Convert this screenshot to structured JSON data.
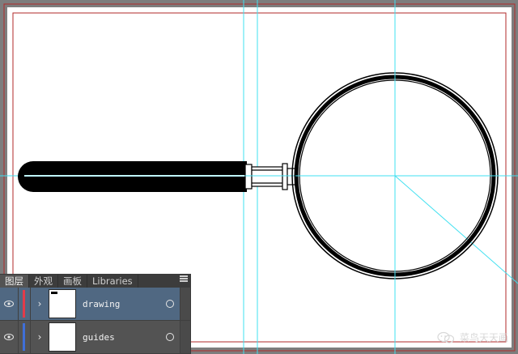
{
  "layers_panel": {
    "tabs": [
      {
        "label": "图层",
        "active": true
      },
      {
        "label": "外观",
        "active": false
      },
      {
        "label": "画板",
        "active": false
      },
      {
        "label": "Libraries",
        "active": false
      }
    ],
    "layers": [
      {
        "name": "drawing",
        "color": "#e23b4a",
        "selected": true,
        "icon": "eye-icon"
      },
      {
        "name": "guides",
        "color": "#3f6fd8",
        "selected": false,
        "icon": "eye-icon"
      }
    ]
  },
  "watermark": {
    "text": "菜鸟天天画",
    "icon": "wechat-icon"
  },
  "colors": {
    "guide": "#3fe0f0",
    "artboard_border": "#b12a2a",
    "panel_bg": "#535353",
    "selected_row": "#506882"
  }
}
